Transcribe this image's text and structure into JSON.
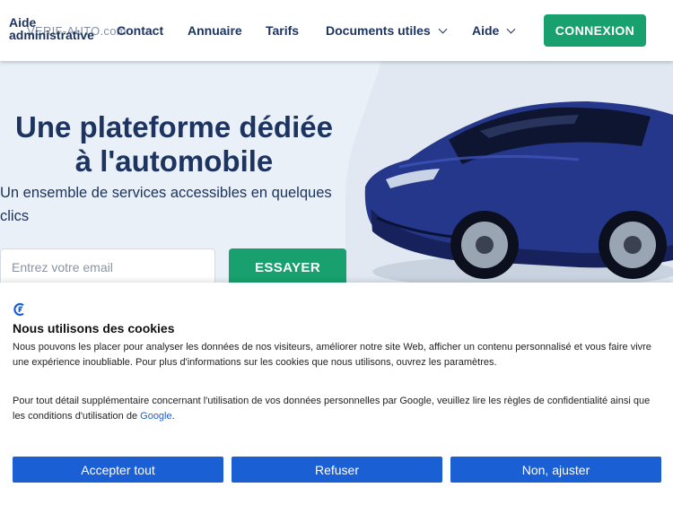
{
  "nav": {
    "logo_text": "Aide administrative",
    "logo_brand": "VERIF-AUTO.com",
    "links": [
      "Contact",
      "Annuaire",
      "Tarifs",
      "Documents utiles",
      "Aide"
    ],
    "login_label": "CONNEXION"
  },
  "hero": {
    "title_line1": "Une plateforme dédiée",
    "title_line2": "à l'automobile",
    "subtitle": "Un ensemble de services accessibles en quelques clics",
    "email_placeholder": "Entrez votre email",
    "cta_label": "ESSAYER"
  },
  "cookie": {
    "title": "Nous utilisons des cookies",
    "paragraph1": "Nous pouvons les placer pour analyser les données de nos visiteurs, améliorer notre site Web, afficher un contenu personnalisé et vous faire vivre une expérience inoubliable. Pour plus d'informations sur les cookies que nous utilisons, ouvrez les paramètres.",
    "paragraph2": "Pour tout détail supplémentaire concernant l'utilisation de vos données personnelles par Google, veuillez lire les règles de confidentialité ainsi que les conditions d'utilisation de",
    "google_link": "Google",
    "accept_label": "Accepter tout",
    "refuse_label": "Refuser",
    "adjust_label": "Non, ajuster"
  },
  "colors": {
    "navy": "#1d3461",
    "green": "#18a06e",
    "blue": "#1a5fd4",
    "hero_bg": "#e9f0f8"
  }
}
